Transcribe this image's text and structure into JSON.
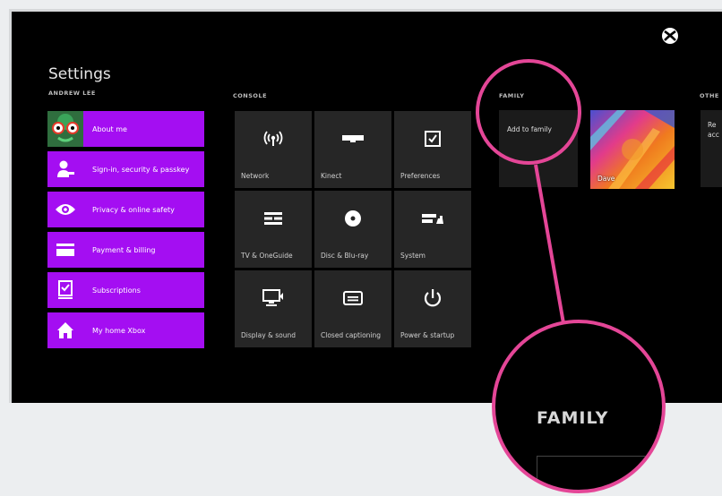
{
  "page": {
    "title": "Settings",
    "accent": "#a40ef2",
    "highlight_color": "#e44697"
  },
  "user": {
    "name": "ANDREW LEE",
    "menu": [
      {
        "label": "About me",
        "icon": "avatar-icon"
      },
      {
        "label": "Sign-in, security & passkey",
        "icon": "user-key-icon"
      },
      {
        "label": "Privacy & online safety",
        "icon": "eye-icon"
      },
      {
        "label": "Payment & billing",
        "icon": "credit-card-icon"
      },
      {
        "label": "Subscriptions",
        "icon": "subscription-icon"
      },
      {
        "label": "My home Xbox",
        "icon": "home-icon"
      }
    ]
  },
  "console": {
    "heading": "CONSOLE",
    "tiles": [
      {
        "label": "Network",
        "icon": "network-icon"
      },
      {
        "label": "Kinect",
        "icon": "kinect-icon"
      },
      {
        "label": "Preferences",
        "icon": "checkbox-icon"
      },
      {
        "label": "TV & OneGuide",
        "icon": "tv-guide-icon"
      },
      {
        "label": "Disc & Blu-ray",
        "icon": "disc-icon"
      },
      {
        "label": "System",
        "icon": "system-icon"
      },
      {
        "label": "Display & sound",
        "icon": "display-icon"
      },
      {
        "label": "Closed captioning",
        "icon": "captioning-icon"
      },
      {
        "label": "Power & startup",
        "icon": "power-icon"
      }
    ]
  },
  "family": {
    "heading": "FAMILY",
    "add_label": "Add to family",
    "member": {
      "name": "Dave"
    }
  },
  "other": {
    "heading": "OTHE",
    "line1": "Re",
    "line2": "acc"
  },
  "zoom_callout": {
    "text": "FAMILY"
  }
}
